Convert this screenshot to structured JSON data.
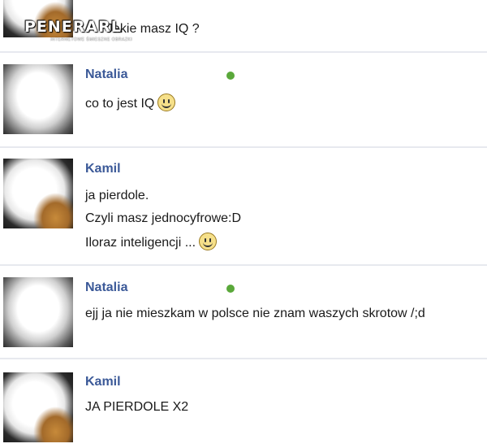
{
  "watermark": {
    "title": "PENERARL",
    "subtitle": "INTERNETOWE ŚMIESZNE OBRAZKI"
  },
  "messages": [
    {
      "author": "",
      "lines": [
        "Jakie masz IQ ?"
      ],
      "online": false
    },
    {
      "author": "Natalia",
      "lines": [
        "co to jest IQ"
      ],
      "online": true,
      "smileys": [
        0
      ]
    },
    {
      "author": "Kamil",
      "lines": [
        "ja pierdole.",
        "Czyli masz jednocyfrowe:D",
        "Iloraz inteligencji ..."
      ],
      "online": false,
      "smileys": [
        2
      ]
    },
    {
      "author": "Natalia",
      "lines": [
        "ejj ja nie mieszkam w polsce nie znam waszych skrotow /;d"
      ],
      "online": true
    },
    {
      "author": "Kamil",
      "lines": [
        "JA PIERDOLE X2"
      ],
      "online": false
    }
  ],
  "icons": {
    "smiley": "smiley-icon",
    "online": "online-dot-icon"
  },
  "colors": {
    "name": "#3b5998",
    "online": "#5aa83a",
    "separator": "#e7e9ef"
  }
}
